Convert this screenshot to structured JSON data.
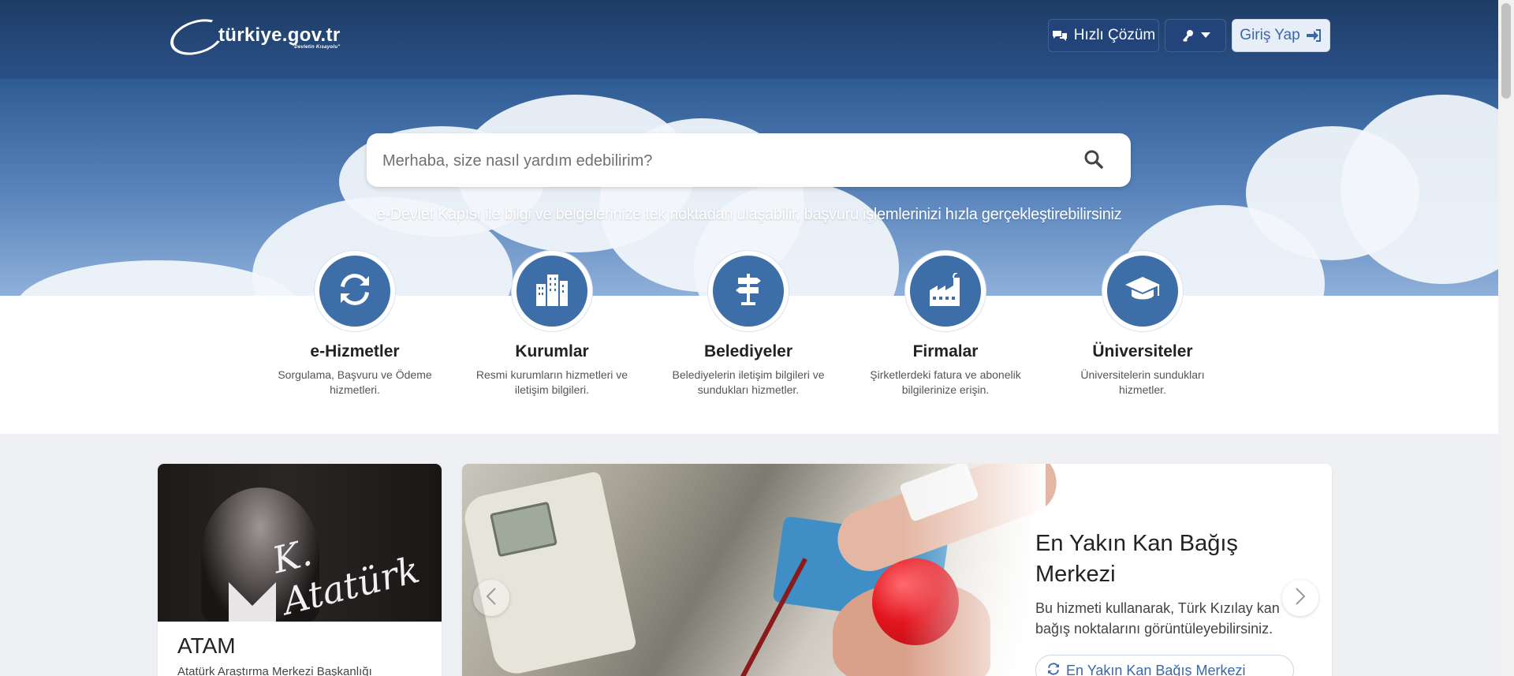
{
  "header": {
    "logo_text": "türkiye.gov.tr",
    "logo_slogan": "\"Devletin Kısayolu\"",
    "quick_label": "Hızlı Çözüm",
    "login_label": "Giriş Yap"
  },
  "search": {
    "placeholder": "Merhaba, size nasıl yardım edebilirim?",
    "value": ""
  },
  "tagline": "e-Devlet Kapısı ile bilgi ve belgelerinize tek noktadan ulaşabilir, başvuru işlemlerinizi hızla gerçekleştirebilirsiniz",
  "categories": [
    {
      "title": "e-Hizmetler",
      "desc": "Sorgulama, Başvuru ve Ödeme hizmetleri.",
      "icon": "refresh-icon"
    },
    {
      "title": "Kurumlar",
      "desc": "Resmi kurumların hizmetleri ve iletişim bilgileri.",
      "icon": "building-icon"
    },
    {
      "title": "Belediyeler",
      "desc": "Belediyelerin iletişim bilgileri ve sundukları hizmetler.",
      "icon": "signpost-icon"
    },
    {
      "title": "Firmalar",
      "desc": "Şirketlerdeki fatura ve abonelik bilgilerinize erişin.",
      "icon": "factory-icon"
    },
    {
      "title": "Üniversiteler",
      "desc": "Üniversitelerin sundukları hizmetler.",
      "icon": "graduation-cap-icon"
    }
  ],
  "atam": {
    "title": "ATAM",
    "subtitle": "Atatürk Araştırma Merkezi Başkanlığı",
    "signature": "K. Atatürk"
  },
  "slider": {
    "title": "En Yakın Kan Bağış Merkezi",
    "desc": "Bu hizmeti kullanarak, Türk Kızılay kan bağış noktalarını görüntüleyebilirsiniz.",
    "link_label": "En Yakın Kan Bağış Merkezi"
  },
  "colors": {
    "header_bg": "#1e3d66",
    "accent_blue": "#3d6ea8",
    "link_blue": "#3a67a8"
  }
}
